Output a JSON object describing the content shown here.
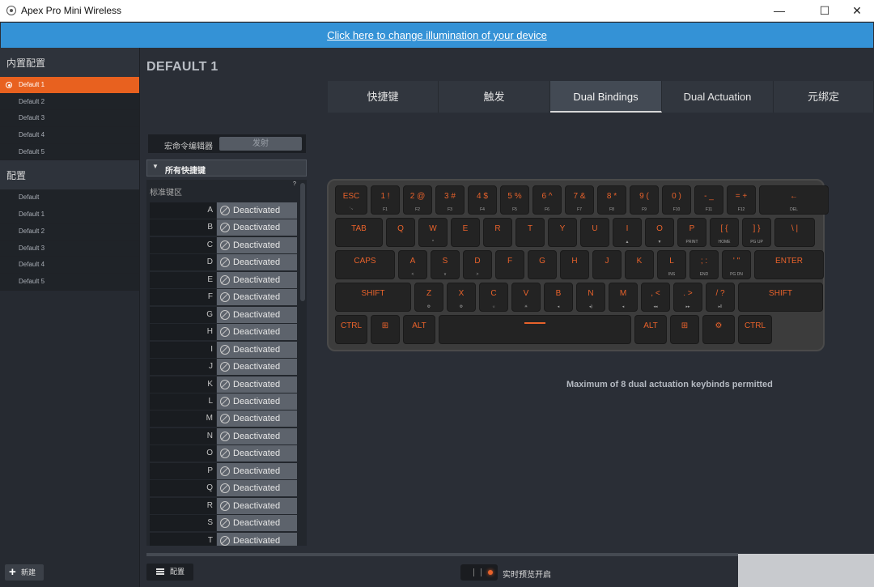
{
  "window": {
    "title": "Apex Pro Mini Wireless",
    "minimize": "—",
    "maximize": "☐",
    "close": "✕"
  },
  "banner": {
    "link_text": "Click here to change illumination of your device"
  },
  "sidebar": {
    "builtin_header": "内置配置",
    "builtin_items": [
      "Default 1",
      "Default 2",
      "Default 3",
      "Default 4",
      "Default 5"
    ],
    "builtin_active": 0,
    "config_header": "配置",
    "config_items": [
      "Default",
      "Default 1",
      "Default 2",
      "Default 3",
      "Default 4",
      "Default 5"
    ],
    "new_button": "新建"
  },
  "main": {
    "title": "DEFAULT 1"
  },
  "tabs": [
    "快捷键",
    "触发",
    "Dual Bindings",
    "Dual Actuation",
    "元绑定"
  ],
  "active_tab": 2,
  "binding_panel": {
    "macro_label": "宏命令编辑器",
    "fire_button": "发射",
    "dropdown": "所有快捷键",
    "section": "标准键区",
    "help": "?",
    "rows": [
      {
        "key": "A",
        "value": "Deactivated"
      },
      {
        "key": "B",
        "value": "Deactivated"
      },
      {
        "key": "C",
        "value": "Deactivated"
      },
      {
        "key": "D",
        "value": "Deactivated"
      },
      {
        "key": "E",
        "value": "Deactivated"
      },
      {
        "key": "F",
        "value": "Deactivated"
      },
      {
        "key": "G",
        "value": "Deactivated"
      },
      {
        "key": "H",
        "value": "Deactivated"
      },
      {
        "key": "I",
        "value": "Deactivated"
      },
      {
        "key": "J",
        "value": "Deactivated"
      },
      {
        "key": "K",
        "value": "Deactivated"
      },
      {
        "key": "L",
        "value": "Deactivated"
      },
      {
        "key": "M",
        "value": "Deactivated"
      },
      {
        "key": "N",
        "value": "Deactivated"
      },
      {
        "key": "O",
        "value": "Deactivated"
      },
      {
        "key": "P",
        "value": "Deactivated"
      },
      {
        "key": "Q",
        "value": "Deactivated"
      },
      {
        "key": "R",
        "value": "Deactivated"
      },
      {
        "key": "S",
        "value": "Deactivated"
      },
      {
        "key": "T",
        "value": "Deactivated"
      }
    ]
  },
  "keyboard": {
    "rows": [
      [
        {
          "l": "ESC",
          "s": "`~"
        },
        {
          "l": "1 !",
          "s": "F1"
        },
        {
          "l": "2 @",
          "s": "F2"
        },
        {
          "l": "3 #",
          "s": "F3"
        },
        {
          "l": "4 $",
          "s": "F4"
        },
        {
          "l": "5 %",
          "s": "F5"
        },
        {
          "l": "6 ^",
          "s": "F6"
        },
        {
          "l": "7 &",
          "s": "F7"
        },
        {
          "l": "8 *",
          "s": "F8"
        },
        {
          "l": "9 (",
          "s": "F9"
        },
        {
          "l": "0 )",
          "s": "F10"
        },
        {
          "l": "- _",
          "s": "F11"
        },
        {
          "l": "= +",
          "s": "F12"
        },
        {
          "l": "←",
          "s": "DEL"
        }
      ],
      [
        {
          "l": "TAB",
          "s": ""
        },
        {
          "l": "Q",
          "s": ""
        },
        {
          "l": "W",
          "s": "^"
        },
        {
          "l": "E",
          "s": ""
        },
        {
          "l": "R",
          "s": ""
        },
        {
          "l": "T",
          "s": ""
        },
        {
          "l": "Y",
          "s": ""
        },
        {
          "l": "U",
          "s": ""
        },
        {
          "l": "I",
          "s": "▲"
        },
        {
          "l": "O",
          "s": "▼"
        },
        {
          "l": "P",
          "s": "PRINT"
        },
        {
          "l": "[ {",
          "s": "HOME"
        },
        {
          "l": "] }",
          "s": "PG UP"
        },
        {
          "l": "\\ |",
          "s": ""
        }
      ],
      [
        {
          "l": "CAPS",
          "s": ""
        },
        {
          "l": "A",
          "s": "<"
        },
        {
          "l": "S",
          "s": "v"
        },
        {
          "l": "D",
          "s": ">"
        },
        {
          "l": "F",
          "s": ""
        },
        {
          "l": "G",
          "s": ""
        },
        {
          "l": "H",
          "s": ""
        },
        {
          "l": "J",
          "s": ""
        },
        {
          "l": "K",
          "s": ""
        },
        {
          "l": "L",
          "s": "INS"
        },
        {
          "l": "; :",
          "s": "END"
        },
        {
          "l": "' \"",
          "s": "PG DN"
        },
        {
          "l": "ENTER",
          "s": ""
        }
      ],
      [
        {
          "l": "SHIFT",
          "s": ""
        },
        {
          "l": "Z",
          "s": "⚙"
        },
        {
          "l": "X",
          "s": "⚙"
        },
        {
          "l": "C",
          "s": "☼"
        },
        {
          "l": "V",
          "s": "☀"
        },
        {
          "l": "B",
          "s": "◂"
        },
        {
          "l": "N",
          "s": "◂)"
        },
        {
          "l": "M",
          "s": "◂"
        },
        {
          "l": ", <",
          "s": "◂◂"
        },
        {
          "l": ". >",
          "s": "▸▸"
        },
        {
          "l": "/ ?",
          "s": "▸ll"
        },
        {
          "l": "SHIFT",
          "s": ""
        }
      ],
      [
        {
          "l": "CTRL",
          "s": ""
        },
        {
          "l": "⊞",
          "s": ""
        },
        {
          "l": "ALT",
          "s": ""
        },
        {
          "l": "",
          "s": ""
        },
        {
          "l": "ALT",
          "s": ""
        },
        {
          "l": "⊞",
          "s": ""
        },
        {
          "l": "⚙",
          "s": ""
        },
        {
          "l": "CTRL",
          "s": ""
        }
      ]
    ]
  },
  "note": "Maximum of 8 dual actuation keybinds permitted",
  "bottom": {
    "config_button": "配置",
    "preview_label": "实时预览开启"
  }
}
